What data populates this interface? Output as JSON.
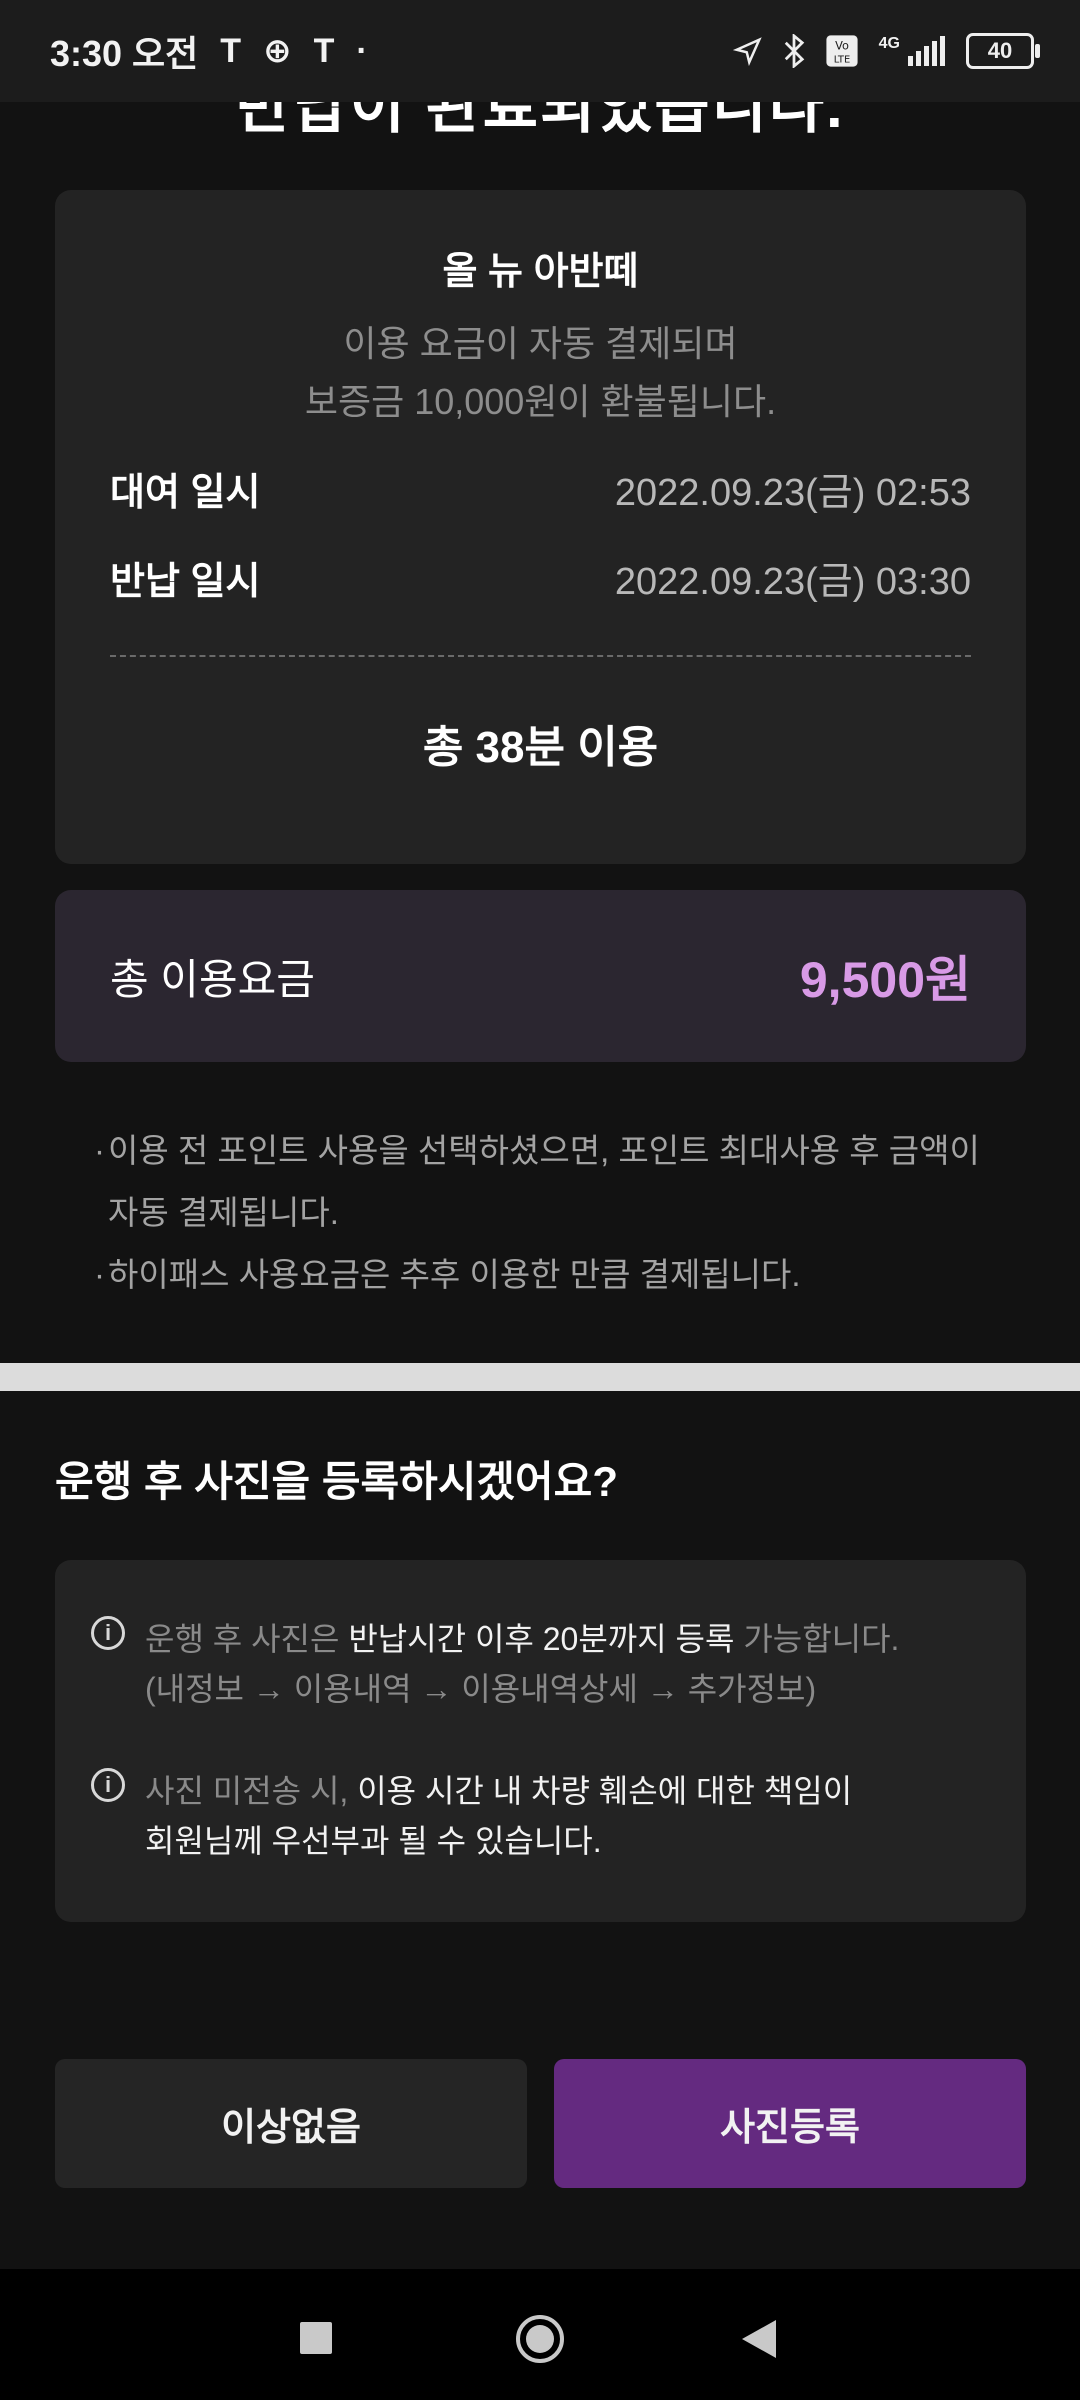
{
  "status_bar": {
    "time": "3:30 오전",
    "carrier_glyphs": [
      "T",
      "⊕",
      "T",
      "·"
    ],
    "network": "4G",
    "battery": "40"
  },
  "header": {
    "partial_title": "반납이 완료되었습니다."
  },
  "rental_card": {
    "vehicle_name": "올 뉴 아반떼",
    "notice_line1": "이용 요금이 자동 결제되며",
    "notice_line2": "보증금 10,000원이 환불됩니다.",
    "rent_label": "대여 일시",
    "rent_value": "2022.09.23(금) 02:53",
    "return_label": "반납 일시",
    "return_value": "2022.09.23(금) 03:30",
    "total_usage": "총 38분 이용"
  },
  "fee": {
    "label": "총 이용요금",
    "value": "9,500원",
    "accent": "#d89ae6"
  },
  "notes": [
    "이용 전 포인트 사용을 선택하셨으면, 포인트 최대사용 후 금액이 자동 결제됩니다.",
    "하이패스 사용요금은 추후 이용한 만큼 결제됩니다."
  ],
  "photo_section": {
    "question": "운행 후 사진을 등록하시겠어요?",
    "info1_a": "운행 후 사진은 ",
    "info1_b": "반납시간 이후 20분까지 등록",
    "info1_c": " 가능합니다.",
    "info1_line2": "(내정보 → 이용내역 → 이용내역상세 → 추가정보)",
    "info2_a": "사진 미전송 시, ",
    "info2_b": "이용 시간 내 차량 훼손에 대한 책임이",
    "info2_line2": "회원님께 우선부과 될 수 있습니다."
  },
  "buttons": {
    "no_issue": "이상없음",
    "register_photo": "사진등록",
    "primary_color": "#642a80"
  }
}
